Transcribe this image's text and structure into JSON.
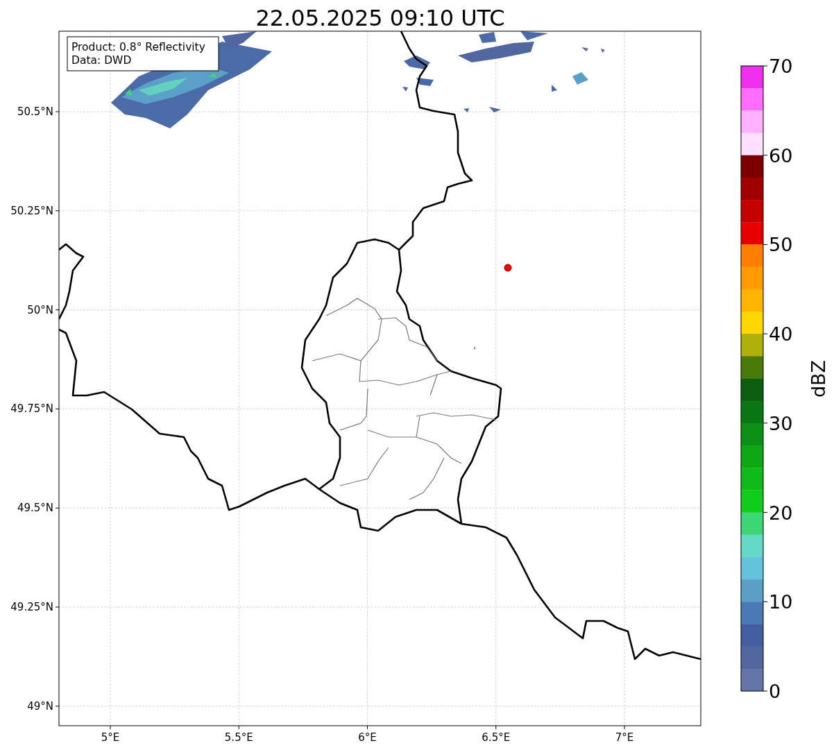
{
  "title": "22.05.2025 09:10 UTC",
  "info_box": {
    "lines": [
      "Product: 0.8° Reflectivity",
      "Data: DWD"
    ]
  },
  "map": {
    "x_ticks": [
      "5°E",
      "5.5°E",
      "6°E",
      "6.5°E",
      "7°E"
    ],
    "y_ticks": [
      "50.5°N",
      "50.25°N",
      "50°N",
      "49.75°N",
      "49.5°N",
      "49.25°N",
      "49°N"
    ]
  },
  "colorbar": {
    "label": "dBZ",
    "ticks": [
      "70",
      "60",
      "50",
      "40",
      "30",
      "20",
      "10",
      "0"
    ],
    "segments": [
      {
        "color": "#ee30ee"
      },
      {
        "color": "#ff6cff"
      },
      {
        "color": "#ffb0ff"
      },
      {
        "color": "#ffe0ff"
      },
      {
        "color": "#7c0000"
      },
      {
        "color": "#a00000"
      },
      {
        "color": "#c40000"
      },
      {
        "color": "#e60000"
      },
      {
        "color": "#ff7e00"
      },
      {
        "color": "#ff9a00"
      },
      {
        "color": "#ffb400"
      },
      {
        "color": "#ffd600"
      },
      {
        "color": "#b0b00a"
      },
      {
        "color": "#4a7a0a"
      },
      {
        "color": "#0a5e0e"
      },
      {
        "color": "#0a7812"
      },
      {
        "color": "#0c9015"
      },
      {
        "color": "#0ea815"
      },
      {
        "color": "#10bb18"
      },
      {
        "color": "#12cc1c"
      },
      {
        "color": "#3ed674"
      },
      {
        "color": "#64d9c6"
      },
      {
        "color": "#64c3dc"
      },
      {
        "color": "#5a9fc8"
      },
      {
        "color": "#4a7ab5"
      },
      {
        "color": "#425ea0"
      },
      {
        "color": "#5266a0"
      },
      {
        "color": "#6475a8"
      }
    ]
  }
}
